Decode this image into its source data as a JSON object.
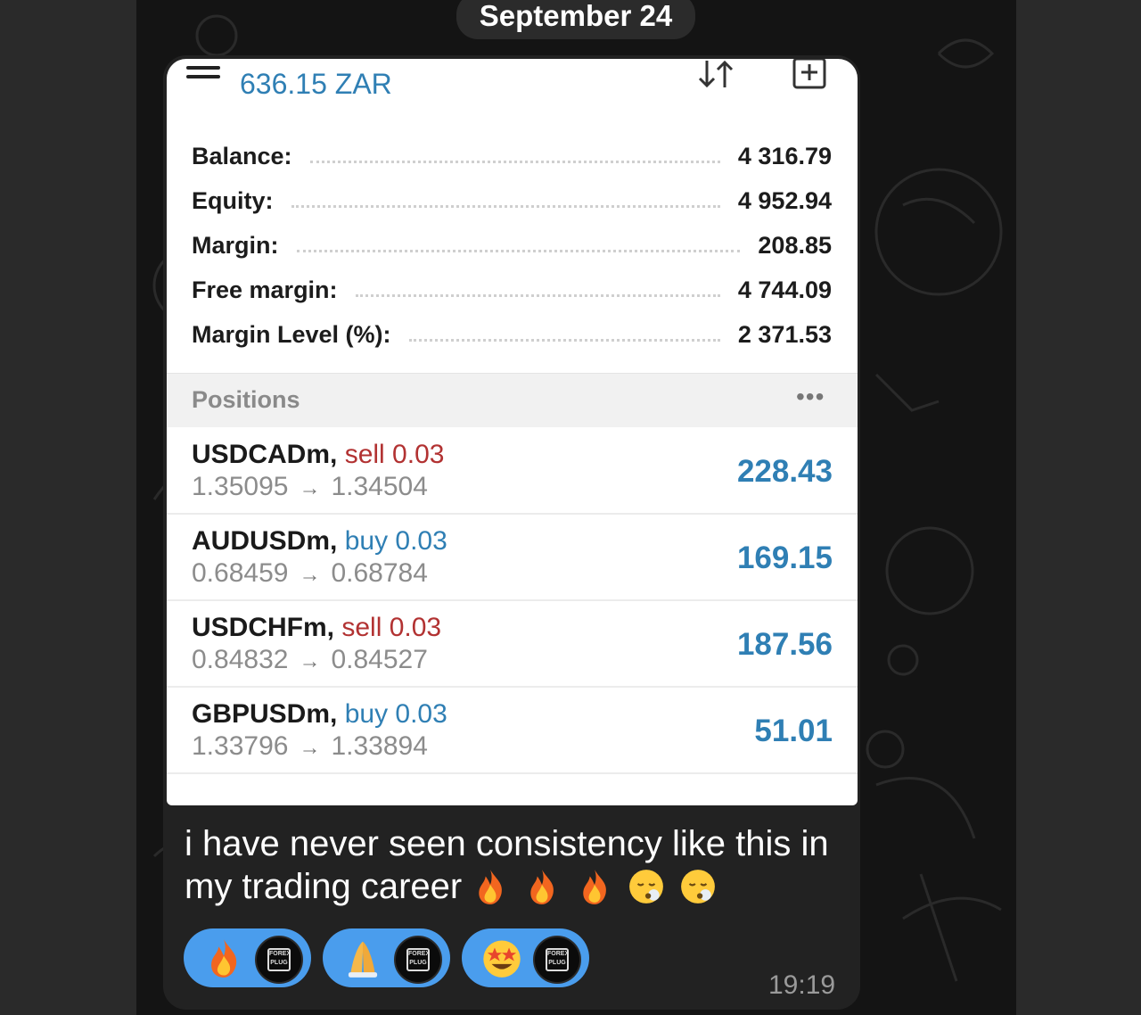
{
  "date_label": "September 24",
  "account": {
    "title": "636.15 ZAR"
  },
  "summary": [
    {
      "label": "Balance:",
      "value": "4 316.79"
    },
    {
      "label": "Equity:",
      "value": "4 952.94"
    },
    {
      "label": "Margin:",
      "value": "208.85"
    },
    {
      "label": "Free margin:",
      "value": "4 744.09"
    },
    {
      "label": "Margin Level (%):",
      "value": "2 371.53"
    }
  ],
  "positions_header": {
    "label": "Positions",
    "more": "•••"
  },
  "positions": [
    {
      "symbol": "USDCADm,",
      "side": "sell 0.03",
      "side_type": "sell",
      "open": "1.35095",
      "arrow": "→",
      "current": "1.34504",
      "profit": "228.43"
    },
    {
      "symbol": "AUDUSDm,",
      "side": "buy 0.03",
      "side_type": "buy",
      "open": "0.68459",
      "arrow": "→",
      "current": "0.68784",
      "profit": "169.15"
    },
    {
      "symbol": "USDCHFm,",
      "side": "sell 0.03",
      "side_type": "sell",
      "open": "0.84832",
      "arrow": "→",
      "current": "0.84527",
      "profit": "187.56"
    },
    {
      "symbol": "GBPUSDm,",
      "side": "buy 0.03",
      "side_type": "buy",
      "open": "1.33796",
      "arrow": "→",
      "current": "1.33894",
      "profit": "51.01"
    }
  ],
  "message": {
    "line1": "i have never seen consistency like this in",
    "line2": "my trading career",
    "emojis": [
      "fire-emoji",
      "fire-emoji",
      "fire-emoji",
      "face-exhaling-emoji",
      "face-exhaling-emoji"
    ]
  },
  "reactions": [
    {
      "emoji": "fire-emoji",
      "avatar_text": "FOREX PLUG"
    },
    {
      "emoji": "folded-hands-emoji",
      "avatar_text": "FOREX PLUG"
    },
    {
      "emoji": "star-struck-emoji",
      "avatar_text": "FOREX PLUG"
    }
  ],
  "time": "19:19",
  "colors": {
    "accent_blue": "#2f7fb4",
    "sell_red": "#b23232",
    "reaction_blue": "#4a9ded",
    "bubble": "#222222"
  }
}
